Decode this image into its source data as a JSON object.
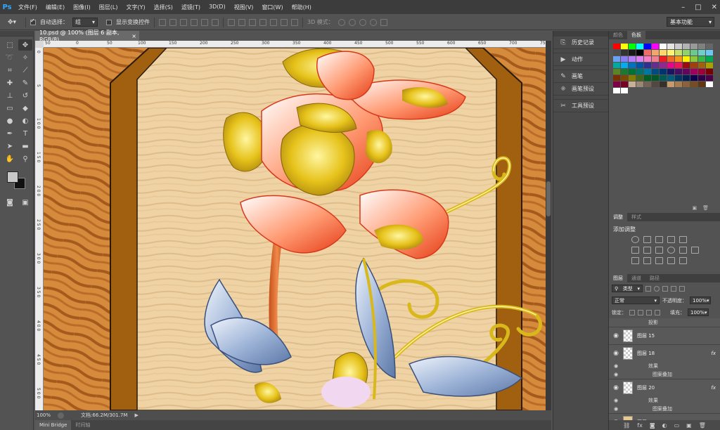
{
  "menubar": {
    "logo": "Ps",
    "items": [
      "文件(F)",
      "编辑(E)",
      "图像(I)",
      "图层(L)",
      "文字(Y)",
      "选择(S)",
      "滤镜(T)",
      "3D(D)",
      "视图(V)",
      "窗口(W)",
      "帮助(H)"
    ]
  },
  "optionsbar": {
    "auto_select_label": "自动选择：",
    "auto_select_value": "组",
    "show_transform_label": "显示变换控件",
    "mode_3d_label": "3D 模式：",
    "workspace": "基本功能"
  },
  "document": {
    "tab_title": "10.psd @ 100% (图层 6 副本, RGB/8)",
    "zoom": "100%",
    "doc_size": "文档:66.2M/301.7M",
    "ruler_h": [
      "50",
      "0",
      "50",
      "100",
      "150",
      "200",
      "250",
      "300",
      "350",
      "400",
      "450",
      "500",
      "550",
      "600",
      "650",
      "700",
      "750"
    ],
    "ruler_v": [
      "0",
      "5",
      "1 0 0",
      "1 5 0",
      "2 0 0",
      "2 5 0",
      "3 0 0",
      "3 5 0",
      "4 0 0",
      "4 5 0",
      "5 0 0"
    ]
  },
  "bottom_tabs": [
    "Mini Bridge",
    "时间轴"
  ],
  "middock": {
    "items": [
      {
        "icon": "history-icon",
        "label": "历史记录"
      },
      {
        "icon": "actions-icon",
        "label": "动作"
      },
      {
        "icon": "brush-icon",
        "label": "画笔"
      },
      {
        "icon": "brush-preset-icon",
        "label": "画笔预设"
      },
      {
        "icon": "tool-preset-icon",
        "label": "工具预设"
      }
    ]
  },
  "color_panel": {
    "tabs": [
      "颜色",
      "色板"
    ],
    "active_tab": 1,
    "swatches": [
      "#ff0000",
      "#ffff00",
      "#00ff00",
      "#00ffff",
      "#0000ff",
      "#ff00ff",
      "#ffffff",
      "#e6e6e6",
      "#cccccc",
      "#b3b3b3",
      "#999999",
      "#808080",
      "#666666",
      "#4d4d4d",
      "#333333",
      "#1a1a1a",
      "#000000",
      "#f26b6b",
      "#f7a46b",
      "#fdd76b",
      "#fff46b",
      "#c6e06b",
      "#8dd46b",
      "#6bc98d",
      "#6bd0c6",
      "#6bc8f2",
      "#6ba0f2",
      "#8a7ff2",
      "#b37ff2",
      "#e07ff2",
      "#f27fc0",
      "#f27f8f",
      "#ed1c24",
      "#f26522",
      "#f7941d",
      "#fff200",
      "#8dc63f",
      "#39b54a",
      "#00a651",
      "#00a99d",
      "#00aeef",
      "#0072bc",
      "#0054a6",
      "#2e3192",
      "#662d91",
      "#92278f",
      "#ec008c",
      "#ed145b",
      "#9e0b0f",
      "#a0410d",
      "#a36209",
      "#aba000",
      "#598527",
      "#1a7b30",
      "#007236",
      "#00746b",
      "#0076a3",
      "#004b80",
      "#003471",
      "#1b1464",
      "#440e62",
      "#630460",
      "#9e005d",
      "#9e0039",
      "#790000",
      "#7b2e00",
      "#7d4900",
      "#827b00",
      "#406618",
      "#005e20",
      "#005826",
      "#005952",
      "#005b7f",
      "#003663",
      "#002157",
      "#0d004c",
      "#32004b",
      "#4b0049",
      "#7b0046",
      "#7a0026",
      "#c7b299",
      "#998675",
      "#736357",
      "#534741",
      "#37302a",
      "#c69c6d",
      "#a67c52",
      "#8c6239",
      "#754c24",
      "#603913",
      "#ffffff",
      "#ffffff",
      "#ffffff"
    ]
  },
  "adjust_panel": {
    "tabs": [
      "调整",
      "样式"
    ],
    "title": "添加调整"
  },
  "layers_panel": {
    "tabs": [
      "图层",
      "通道",
      "路径"
    ],
    "kind": "类型",
    "blend": "正常",
    "opacity_label": "不透明度：",
    "opacity": "100%",
    "lock_label": "锁定：",
    "fill_label": "填充：",
    "fill": "100%",
    "rows": [
      {
        "kind": "sub",
        "name": "投影"
      },
      {
        "kind": "layer",
        "name": "图层 15",
        "fx": false,
        "thumb": "checker"
      },
      {
        "kind": "layer",
        "name": "图层 18",
        "fx": true,
        "thumb": "checker"
      },
      {
        "kind": "sub",
        "name": "效果"
      },
      {
        "kind": "sub2",
        "name": "图案叠加"
      },
      {
        "kind": "layer",
        "name": "图层 20",
        "fx": true,
        "thumb": "checker"
      },
      {
        "kind": "sub",
        "name": "效果"
      },
      {
        "kind": "sub2",
        "name": "图案叠加"
      },
      {
        "kind": "layer",
        "name": "图层 22",
        "fx": false,
        "thumb": "beige"
      }
    ],
    "fx_label": "fx"
  }
}
